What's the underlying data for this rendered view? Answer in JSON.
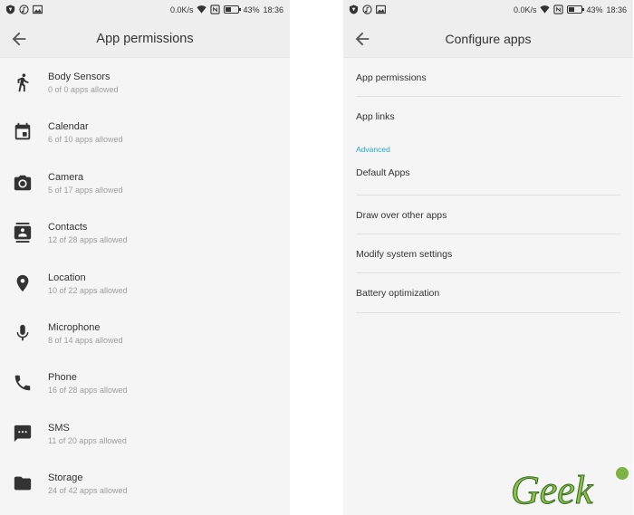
{
  "status_bar": {
    "speed": "0.0K/s",
    "battery": "43%",
    "time": "18:36",
    "battery_level": 0.43
  },
  "left": {
    "title": "App permissions",
    "permissions": [
      {
        "name": "Body Sensors",
        "count": "0 of 0 apps allowed",
        "icon": "body-sensors-icon"
      },
      {
        "name": "Calendar",
        "count": "6 of 10 apps allowed",
        "icon": "calendar-icon"
      },
      {
        "name": "Camera",
        "count": "5 of 17 apps allowed",
        "icon": "camera-icon"
      },
      {
        "name": "Contacts",
        "count": "12 of 28 apps allowed",
        "icon": "contacts-icon"
      },
      {
        "name": "Location",
        "count": "10 of 22 apps allowed",
        "icon": "location-icon"
      },
      {
        "name": "Microphone",
        "count": "8 of 14 apps allowed",
        "icon": "microphone-icon"
      },
      {
        "name": "Phone",
        "count": "16 of 28 apps allowed",
        "icon": "phone-icon"
      },
      {
        "name": "SMS",
        "count": "11 of 20 apps allowed",
        "icon": "sms-icon"
      },
      {
        "name": "Storage",
        "count": "24 of 42 apps allowed",
        "icon": "storage-icon"
      }
    ]
  },
  "right": {
    "title": "Configure apps",
    "items_top": [
      "App permissions",
      "App links"
    ],
    "section_label": "Advanced",
    "items_advanced": [
      "Default Apps",
      "Draw over other apps",
      "Modify system settings",
      "Battery optimization"
    ]
  },
  "colors": {
    "accent": "#26a7c9",
    "app_bar": "#eeeeee",
    "background": "#f5f5f5",
    "secondary_text": "#9e9e9e"
  },
  "watermark": {
    "text": "Geek"
  }
}
